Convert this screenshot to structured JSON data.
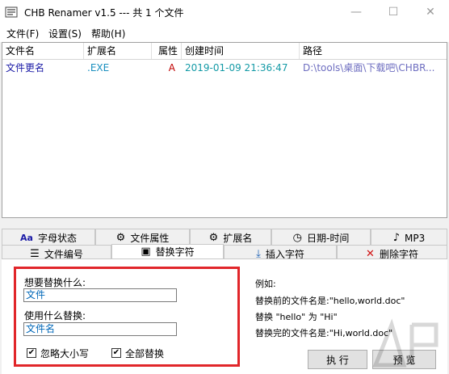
{
  "window": {
    "title": "CHB Renamer v1.5 --- 共 1 个文件",
    "minimize": "—",
    "maximize": "☐",
    "close": "✕"
  },
  "menu": [
    {
      "label": "文件(F)"
    },
    {
      "label": "设置(S)"
    },
    {
      "label": "帮助(H)"
    }
  ],
  "list": {
    "columns": [
      "文件名",
      "扩展名",
      "属性",
      "创建时间",
      "路径"
    ],
    "rows": [
      [
        "文件更名",
        ".EXE",
        "A",
        "2019-01-09 21:36:47",
        "D:\\tools\\桌面\\下载吧\\CHBR..."
      ]
    ]
  },
  "tabs": {
    "row1": [
      {
        "label": "字母状态",
        "icon": "Aa"
      },
      {
        "label": "文件属性",
        "icon": "⚙"
      },
      {
        "label": "扩展名",
        "icon": "⚙"
      },
      {
        "label": "日期-时间",
        "icon": "◷"
      },
      {
        "label": "MP3",
        "icon": "♪"
      }
    ],
    "row2": [
      {
        "label": "文件编号",
        "icon": "☰"
      },
      {
        "label": "替换字符",
        "icon": "▣"
      },
      {
        "label": "插入字符",
        "icon": "⤓"
      },
      {
        "label": "删除字符",
        "icon": "✕"
      }
    ]
  },
  "replace_panel": {
    "find_label": "想要替换什么:",
    "find_value": "文件",
    "replace_label": "使用什么替换:",
    "replace_value": "文件名",
    "ignore_case_label": "忽略大小写",
    "ignore_case_checked": true,
    "replace_all_label": "全部替换",
    "replace_all_checked": true
  },
  "example": {
    "title": "例如:",
    "line1": "替换前的文件名是:\"hello,world.doc\"",
    "line2": "替换 \"hello\" 为 \"Hi\"",
    "line3": "替换完的文件名是:\"Hi,world.doc\""
  },
  "buttons": {
    "execute": "执 行",
    "preview": "预 览"
  },
  "colors": {
    "row_filename": "#1a1aa6",
    "row_ext": "#1a8fbf",
    "row_attr": "#c00000",
    "row_date": "#139aa6",
    "row_path": "#6d6dc0",
    "highlight_border": "#e1262a"
  }
}
